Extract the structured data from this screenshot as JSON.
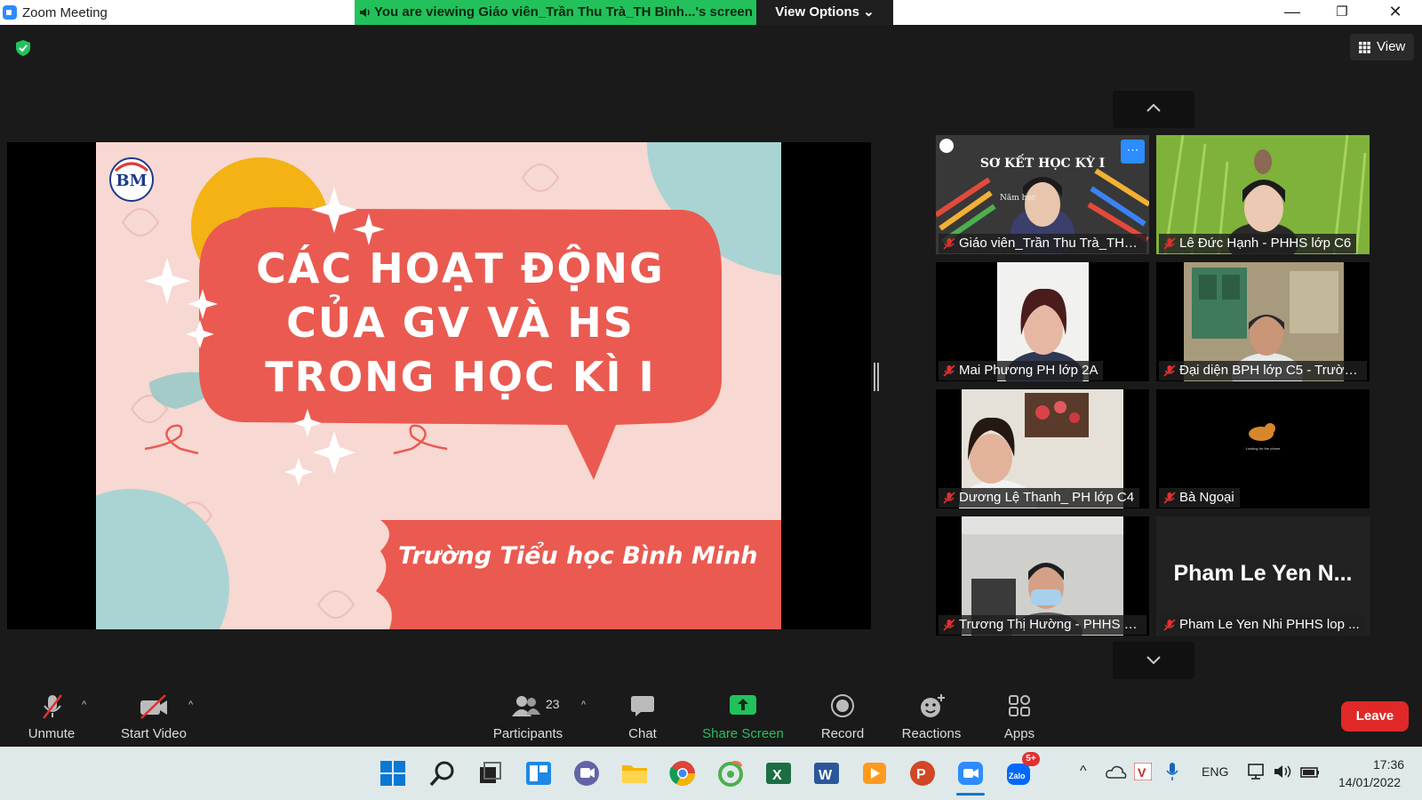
{
  "window": {
    "title": "Zoom Meeting",
    "viewing_banner": "You are viewing Giáo viên_Trần Thu Trà_TH Bình...'s screen",
    "view_options": "View Options ⌄"
  },
  "header": {
    "view_label": "View"
  },
  "colors": {
    "banner_green": "#23c15c",
    "zoom_blue": "#2d8cff",
    "leave_red": "#e02828",
    "slide_coral": "#ea5a50",
    "muted_red": "#e03030"
  },
  "slide": {
    "logo_text": "BM",
    "title_lines": [
      "CÁC HOẠT ĐỘNG",
      "CỦA GV VÀ HS",
      "TRONG HỌC KÌ I"
    ],
    "school": "Trường Tiểu học Bình Minh"
  },
  "gallery": {
    "participants": [
      {
        "name": "Giáo viên_Trần Thu Trà_TH B...",
        "muted": true,
        "overlay_title": "SƠ KẾT HỌC KỲ I",
        "overlay_sub": "Năm học"
      },
      {
        "name": "Lê Đức Hạnh - PHHS lớp C6",
        "muted": true
      },
      {
        "name": "Mai Phương PH lớp 2A",
        "muted": true
      },
      {
        "name": "Đại diện BPH lớp C5 - Trườn...",
        "muted": true
      },
      {
        "name": "Dương Lệ Thanh_ PH lớp C4",
        "muted": true
      },
      {
        "name": "Bà Ngoại",
        "muted": true,
        "overlay_sub": "Looking for the phone"
      },
      {
        "name": "Trương Thị Hường - PHHS 1...",
        "muted": true
      },
      {
        "name": "Pham Le Yen Nhi PHHS lop ...",
        "muted": true,
        "big_name": "Pham Le Yen N..."
      }
    ]
  },
  "toolbar": {
    "unmute": "Unmute",
    "start_video": "Start Video",
    "participants_label": "Participants",
    "participants_count": "23",
    "chat": "Chat",
    "share_screen": "Share Screen",
    "record": "Record",
    "reactions": "Reactions",
    "apps": "Apps",
    "leave": "Leave"
  },
  "taskbar": {
    "language": "ENG",
    "time": "17:36",
    "date": "14/01/2022",
    "zalo_badge": "5+"
  }
}
